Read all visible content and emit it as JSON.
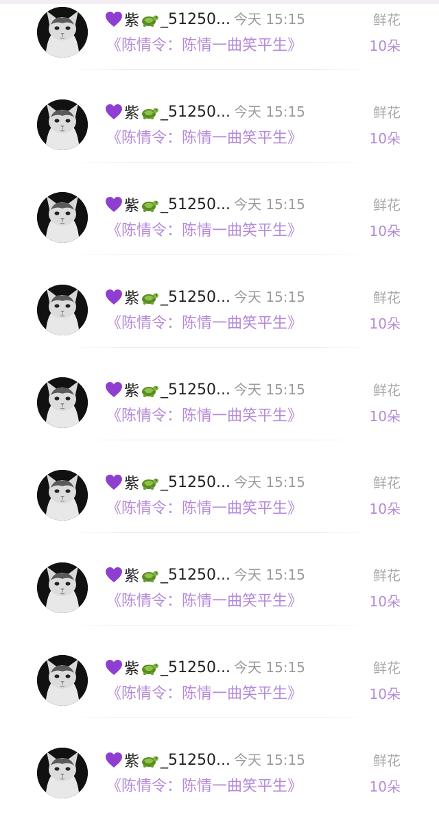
{
  "colors": {
    "book_title": "#b48ad8",
    "gift_count": "#b48ad8",
    "name": "#222222",
    "muted": "#9a9a9a"
  },
  "records": [
    {
      "avatar_icon": "cat-avatar-icon",
      "name_prefix": "紫",
      "name_suffix": "_51250...",
      "time": "今天 15:15",
      "book_title": "《陈情令：陈情一曲笑平生》",
      "gift_label": "鲜花",
      "gift_count": "10朵"
    },
    {
      "avatar_icon": "cat-avatar-icon",
      "name_prefix": "紫",
      "name_suffix": "_51250...",
      "time": "今天 15:15",
      "book_title": "《陈情令：陈情一曲笑平生》",
      "gift_label": "鲜花",
      "gift_count": "10朵"
    },
    {
      "avatar_icon": "cat-avatar-icon",
      "name_prefix": "紫",
      "name_suffix": "_51250...",
      "time": "今天 15:15",
      "book_title": "《陈情令：陈情一曲笑平生》",
      "gift_label": "鲜花",
      "gift_count": "10朵"
    },
    {
      "avatar_icon": "cat-avatar-icon",
      "name_prefix": "紫",
      "name_suffix": "_51250...",
      "time": "今天 15:15",
      "book_title": "《陈情令：陈情一曲笑平生》",
      "gift_label": "鲜花",
      "gift_count": "10朵"
    },
    {
      "avatar_icon": "cat-avatar-icon",
      "name_prefix": "紫",
      "name_suffix": "_51250...",
      "time": "今天 15:15",
      "book_title": "《陈情令：陈情一曲笑平生》",
      "gift_label": "鲜花",
      "gift_count": "10朵"
    },
    {
      "avatar_icon": "cat-avatar-icon",
      "name_prefix": "紫",
      "name_suffix": "_51250...",
      "time": "今天 15:15",
      "book_title": "《陈情令：陈情一曲笑平生》",
      "gift_label": "鲜花",
      "gift_count": "10朵"
    },
    {
      "avatar_icon": "cat-avatar-icon",
      "name_prefix": "紫",
      "name_suffix": "_51250...",
      "time": "今天 15:15",
      "book_title": "《陈情令：陈情一曲笑平生》",
      "gift_label": "鲜花",
      "gift_count": "10朵"
    },
    {
      "avatar_icon": "cat-avatar-icon",
      "name_prefix": "紫",
      "name_suffix": "_51250...",
      "time": "今天 15:15",
      "book_title": "《陈情令：陈情一曲笑平生》",
      "gift_label": "鲜花",
      "gift_count": "10朵"
    },
    {
      "avatar_icon": "cat-avatar-icon",
      "name_prefix": "紫",
      "name_suffix": "_51250...",
      "time": "今天 15:15",
      "book_title": "《陈情令：陈情一曲笑平生》",
      "gift_label": "鲜花",
      "gift_count": "10朵"
    }
  ]
}
